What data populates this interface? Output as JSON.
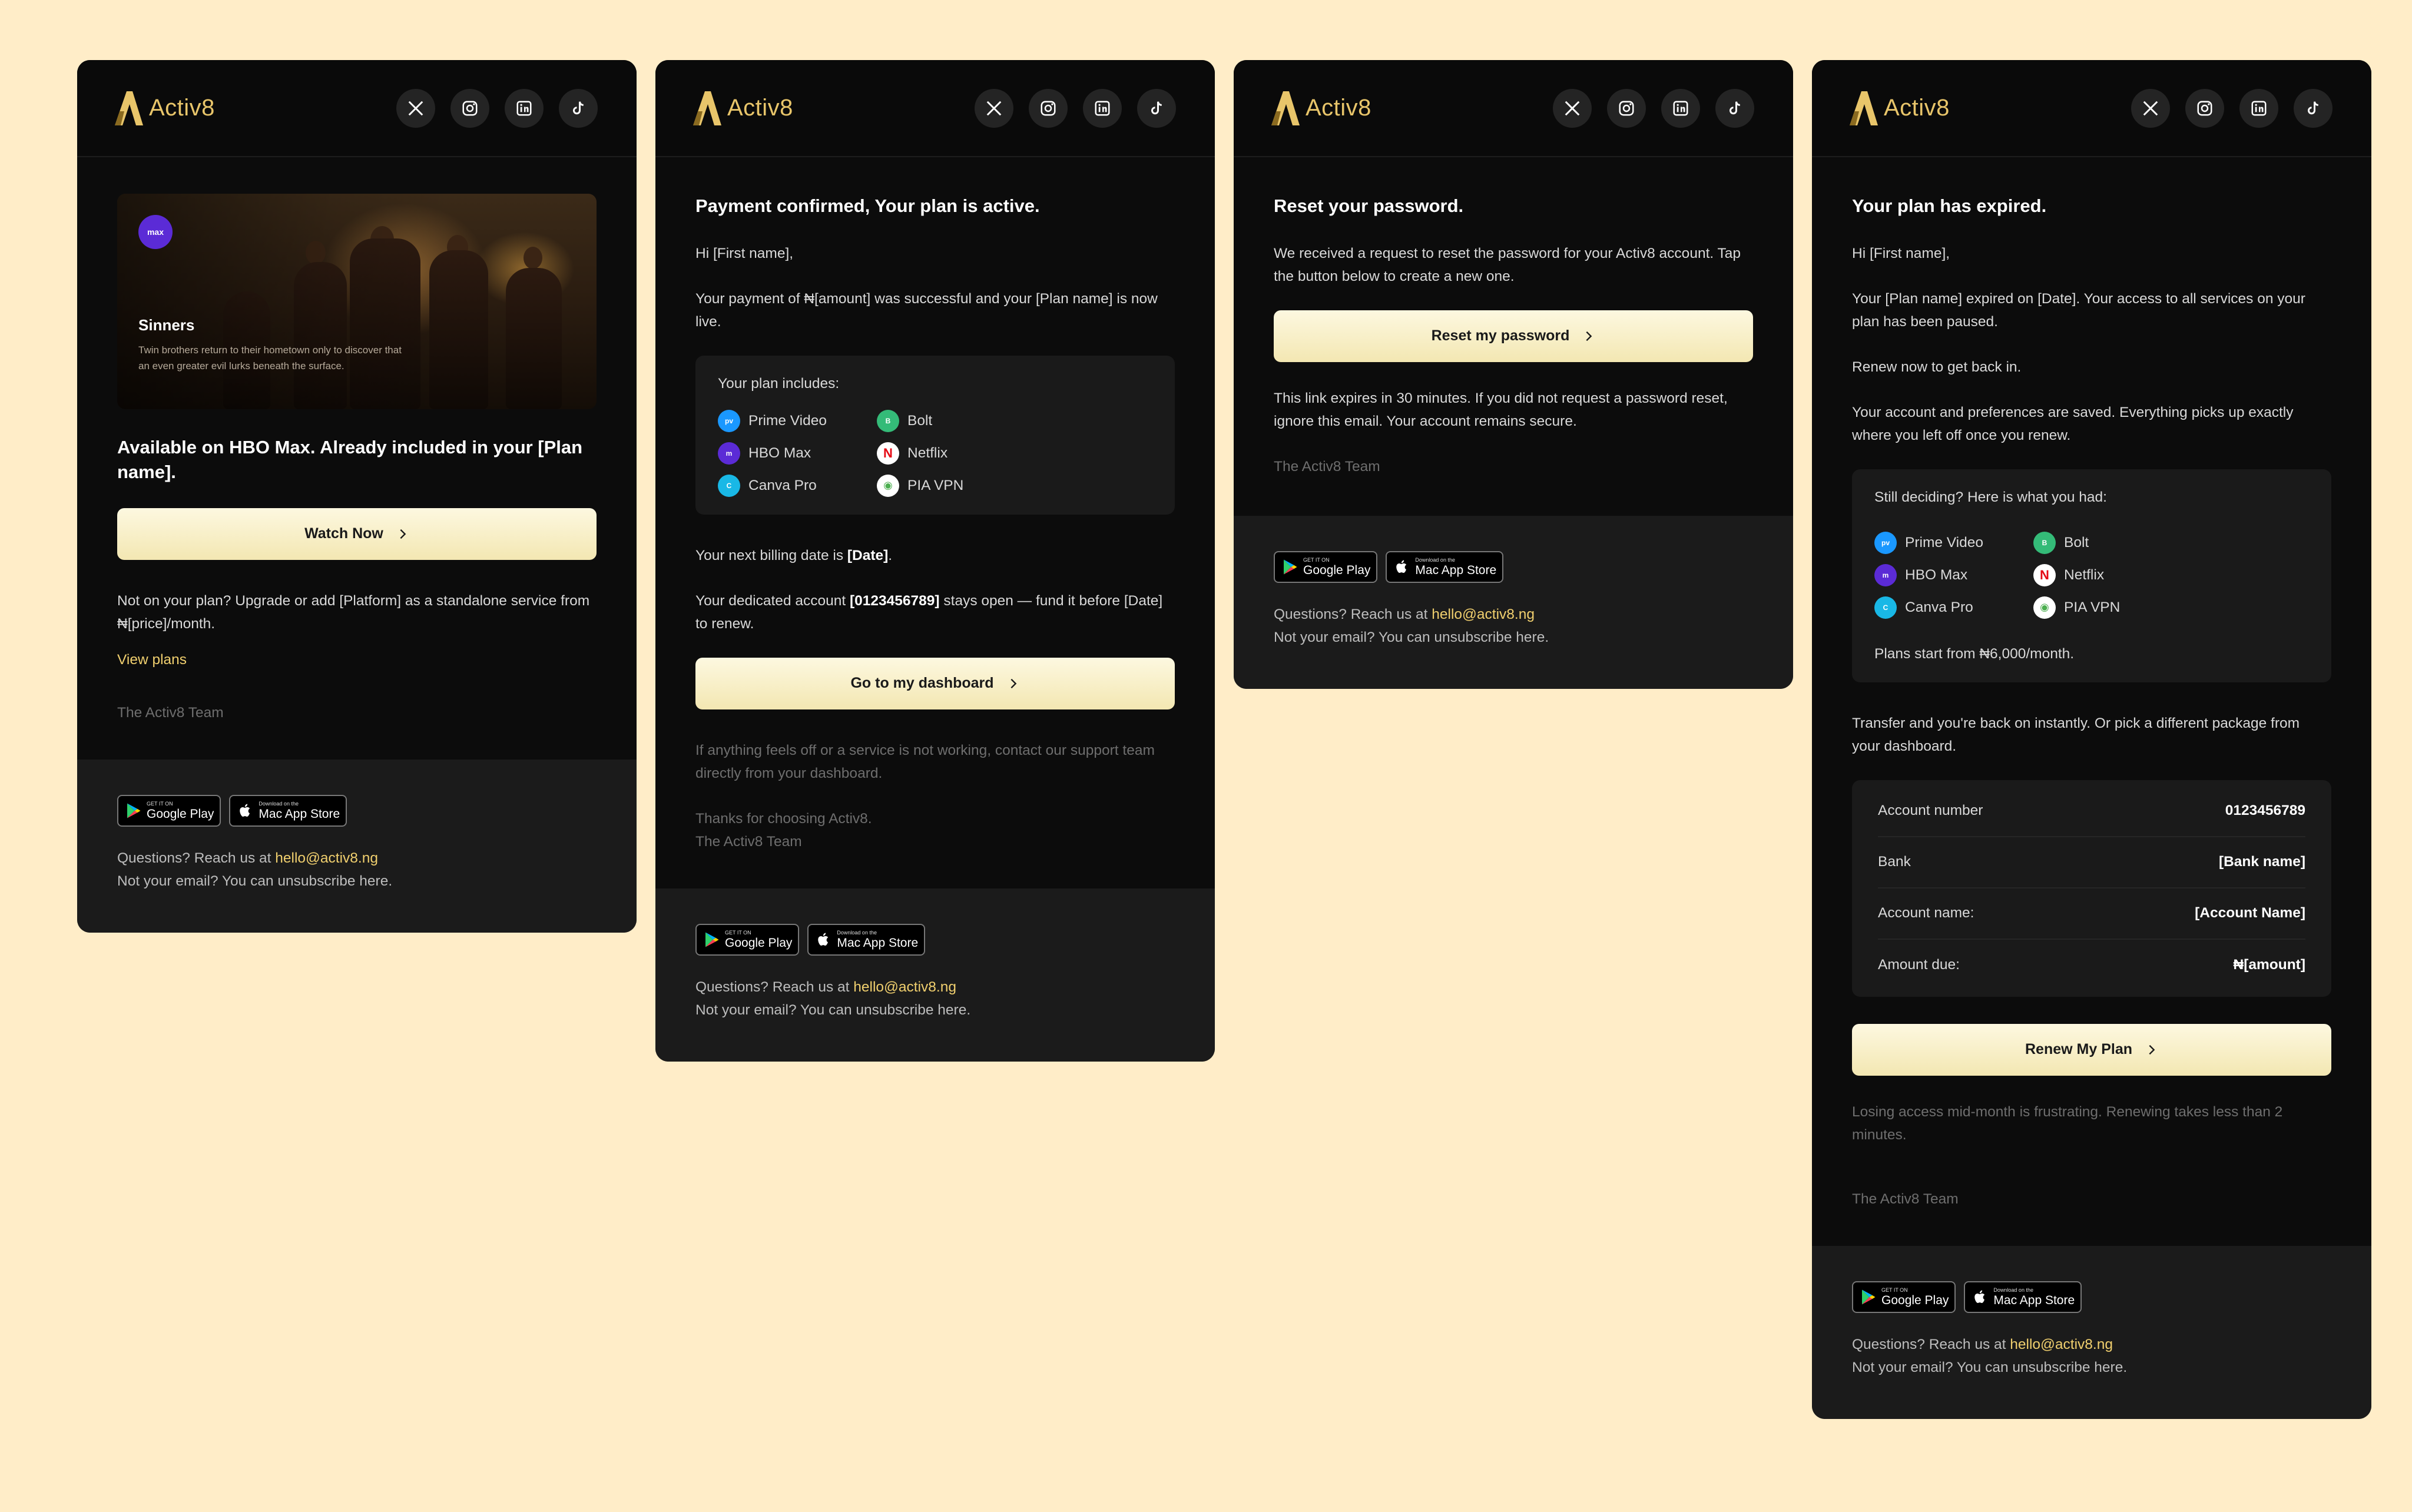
{
  "brand": {
    "name": "Activ8",
    "accent": "#e8c56a",
    "background": "#ffedc8"
  },
  "socials": [
    {
      "name": "x-icon"
    },
    {
      "name": "instagram-icon"
    },
    {
      "name": "linkedin-icon"
    },
    {
      "name": "tiktok-icon"
    }
  ],
  "footer": {
    "google_play_small": "GET IT ON",
    "google_play_label": "Google Play",
    "app_store_small": "Download on the",
    "app_store_label": "Mac App Store",
    "questions_prefix": "Questions? Reach us at ",
    "email": "hello@activ8.ng",
    "unsubscribe": "Not your email? You can unsubscribe here."
  },
  "email1": {
    "hero_badge": "max",
    "hero_title": "Sinners",
    "hero_desc": "Twin brothers return to their hometown only to discover that an even greater evil lurks beneath the surface.",
    "heading": "Available on HBO Max. Already included in your [Plan name].",
    "button": "Watch Now",
    "body": "Not on your plan? Upgrade or add [Platform] as a standalone service from ₦[price]/month.",
    "link": "View plans",
    "signoff": "The Activ8 Team"
  },
  "email2": {
    "heading": "Payment confirmed, Your plan is active.",
    "greeting": "Hi [First name],",
    "p1": "Your payment of ₦[amount] was successful and your [Plan name] is now live.",
    "box_title": "Your plan includes:",
    "services": [
      {
        "label": "Prime Video",
        "icon": "prime-video-icon",
        "color": "#1a98ff"
      },
      {
        "label": "Bolt",
        "icon": "bolt-icon",
        "color": "#34bb78"
      },
      {
        "label": "HBO Max",
        "icon": "hbo-max-icon",
        "color": "#5b2bd6"
      },
      {
        "label": "Netflix",
        "icon": "netflix-icon",
        "color": "#e50914"
      },
      {
        "label": "Canva Pro",
        "icon": "canva-icon",
        "color": "#19b8e6"
      },
      {
        "label": "PIA VPN",
        "icon": "pia-vpn-icon",
        "color": "#4caf50"
      }
    ],
    "billing_prefix": "Your next billing date is ",
    "billing_date": "[Date]",
    "billing_suffix": ".",
    "account_prefix": "Your dedicated account ",
    "account_number": "[0123456789]",
    "account_suffix": " stays open — fund it before [Date] to renew.",
    "button": "Go to my dashboard",
    "support": "If anything feels off or a service is not working, contact our support team directly from your dashboard.",
    "thanks": "Thanks for choosing Activ8.",
    "signoff": "The Activ8 Team"
  },
  "email3": {
    "heading": "Reset your password.",
    "p1": "We received a request to reset the password for your Activ8 account. Tap the button below to create a new one.",
    "button": "Reset my password",
    "p2": "This link expires in 30 minutes. If you did not request a password reset, ignore this email. Your account remains secure.",
    "signoff": "The Activ8 Team"
  },
  "email4": {
    "heading": "Your plan has expired.",
    "greeting": "Hi [First name],",
    "p1": "Your [Plan name] expired on [Date]. Your access to all services on your plan has been paused.",
    "p2": "Renew now to get back in.",
    "p3": "Your account and preferences are saved. Everything picks up exactly where you left off once you renew.",
    "box_title": "Still deciding? Here is what you had:",
    "services": [
      {
        "label": "Prime Video",
        "icon": "prime-video-icon",
        "color": "#1a98ff"
      },
      {
        "label": "Bolt",
        "icon": "bolt-icon",
        "color": "#34bb78"
      },
      {
        "label": "HBO Max",
        "icon": "hbo-max-icon",
        "color": "#5b2bd6"
      },
      {
        "label": "Netflix",
        "icon": "netflix-icon",
        "color": "#e50914"
      },
      {
        "label": "Canva Pro",
        "icon": "canva-icon",
        "color": "#19b8e6"
      },
      {
        "label": "PIA VPN",
        "icon": "pia-vpn-icon",
        "color": "#4caf50"
      }
    ],
    "plans_start": "Plans start from ₦6,000/month.",
    "transfer": "Transfer and you're back on instantly. Or pick a different package from your dashboard.",
    "account": [
      {
        "label": "Account number",
        "value": "0123456789"
      },
      {
        "label": "Bank",
        "value": "[Bank name]"
      },
      {
        "label": "Account name:",
        "value": "[Account Name]"
      },
      {
        "label": "Amount due:",
        "value": "₦[amount]"
      }
    ],
    "button": "Renew My Plan",
    "note": "Losing access mid-month is frustrating. Renewing takes less than 2 minutes.",
    "signoff": "The Activ8 Team"
  }
}
